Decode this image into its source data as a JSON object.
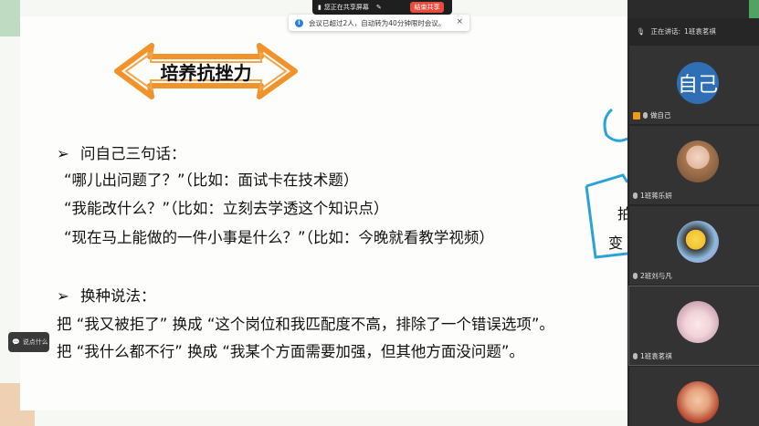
{
  "meeting": {
    "share_status": "您正在共享屏幕",
    "stop_share": "结束共享",
    "notice": "会议已超过2人，自动转为40分钟限时会议。",
    "notice_close": "×"
  },
  "slide": {
    "title": "培养抗挫力",
    "section1_heading": "问自己三句话：",
    "q1": "“哪儿出问题了？”（比如：面试卡在技术题）",
    "q2": "“我能改什么？”（比如：立刻去学透这个知识点）",
    "q3": "“现在马上能做的一件小事是什么？”（比如：今晚就看教学视频）",
    "section2_heading": "换种说法：",
    "line1": "把 “我又被拒了” 换成 “这个岗位和我匹配度不高，排除了一个错误选项”。",
    "line2": "把 “我什么都不行” 换成 “我某个方面需要加强，但其他方面没问题”。",
    "doodle_text_1": "拍",
    "doodle_text_2": "变",
    "chat_hint": "说点什么"
  },
  "participants_panel": {
    "speaking_label": "正在讲话:",
    "speaking_name": "1班袁茗祺",
    "participants": [
      {
        "name": "做自己",
        "avatar_text": "自己",
        "is_self": true
      },
      {
        "name": "1班蒋乐妍",
        "avatar_text": ""
      },
      {
        "name": "2班刘与凡",
        "avatar_text": ""
      },
      {
        "name": "1班袁茗祺",
        "avatar_text": ""
      },
      {
        "name": "",
        "avatar_text": ""
      }
    ]
  },
  "colors": {
    "accent_orange": "#f0932b",
    "self_avatar": "#2f6fb5",
    "stop_button": "#e84c3d",
    "info_blue": "#2a7de1"
  }
}
